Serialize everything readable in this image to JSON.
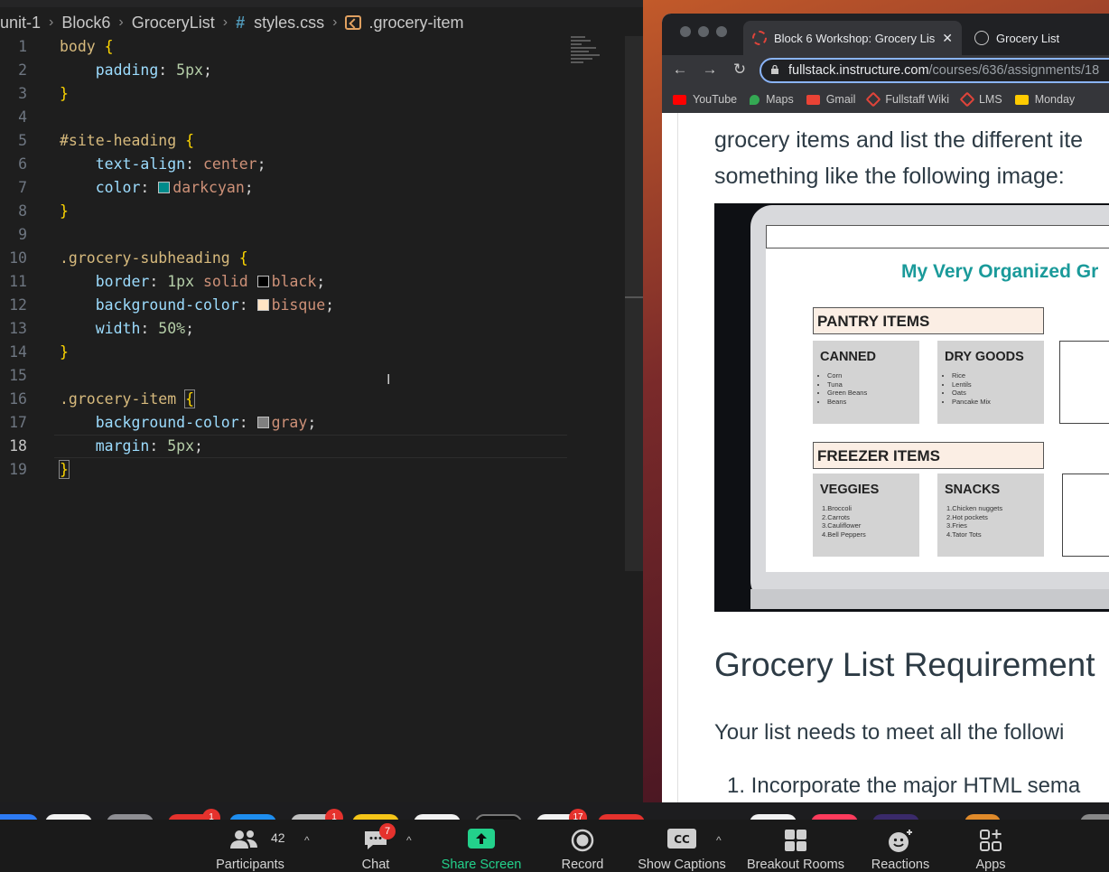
{
  "editor": {
    "breadcrumb": [
      "unit-1",
      "Block6",
      "GroceryList",
      "styles.css",
      ".grocery-item"
    ],
    "lines": [
      {
        "n": "1",
        "code": "body {"
      },
      {
        "n": "2",
        "code": "padding: 5px;"
      },
      {
        "n": "3",
        "code": "}"
      },
      {
        "n": "4",
        "code": ""
      },
      {
        "n": "5",
        "code": "#site-heading {"
      },
      {
        "n": "6",
        "code": "text-align: center;"
      },
      {
        "n": "7",
        "code": "color: darkcyan;"
      },
      {
        "n": "8",
        "code": "}"
      },
      {
        "n": "9",
        "code": ""
      },
      {
        "n": "10",
        "code": ".grocery-subheading {"
      },
      {
        "n": "11",
        "code": "border: 1px solid black;"
      },
      {
        "n": "12",
        "code": "background-color: bisque;"
      },
      {
        "n": "13",
        "code": "width: 50%;"
      },
      {
        "n": "14",
        "code": "}"
      },
      {
        "n": "15",
        "code": ""
      },
      {
        "n": "16",
        "code": ".grocery-item {"
      },
      {
        "n": "17",
        "code": "background-color: gray;"
      },
      {
        "n": "18",
        "code": "margin: 5px;"
      },
      {
        "n": "19",
        "code": "}"
      }
    ],
    "active_line": 18
  },
  "colors": {
    "darkcyan": "#008b8b",
    "black": "#000000",
    "bisque": "#ffe4c4",
    "gray": "#808080",
    "zoom_share_green": "#23d18b"
  },
  "browser": {
    "tabs": [
      {
        "label": "Block 6 Workshop: Grocery Lis",
        "icon": "canvas-icon"
      },
      {
        "label": "Grocery List",
        "icon": "globe-icon"
      }
    ],
    "url_host": "fullstack.instructure.com",
    "url_path": "/courses/636/assignments/18",
    "bookmarks": [
      "YouTube",
      "Maps",
      "Gmail",
      "Fullstaff Wiki",
      "LMS",
      "Monday"
    ],
    "intro_line1": "grocery items and list the different ite",
    "intro_line2": "something like the following image:",
    "figure": {
      "title": "My Very Organized Gr",
      "pantry": "PANTRY ITEMS",
      "canned": {
        "title": "CANNED",
        "items": [
          "Corn",
          "Tuna",
          "Green Beans",
          "Beans"
        ]
      },
      "dry": {
        "title": "DRY GOODS",
        "items": [
          "Rice",
          "Lentils",
          "Oats",
          "Pancake Mix"
        ]
      },
      "freezer": "FREEZER ITEMS",
      "veggies": {
        "title": "VEGGIES",
        "items": [
          "1.Broccoli",
          "2.Carrots",
          "3.Cauliflower",
          "4.Bell Peppers"
        ]
      },
      "snacks": {
        "title": "SNACKS",
        "items": [
          "1.Chicken nuggets",
          "2.Hot pockets",
          "3.Fries",
          "4.Tator Tots"
        ]
      }
    },
    "requirements_heading": "Grocery List Requirement",
    "requirements_intro": "Your list needs to meet all the followi",
    "requirements_item1": "1. Incorporate the major HTML sema"
  },
  "zoom": {
    "participants": {
      "label": "Participants",
      "count": "42"
    },
    "chat": {
      "label": "Chat",
      "badge": "7"
    },
    "share": {
      "label": "Share Screen"
    },
    "record": {
      "label": "Record"
    },
    "captions": {
      "label": "Show Captions"
    },
    "breakout": {
      "label": "Breakout Rooms"
    },
    "reactions": {
      "label": "Reactions"
    },
    "apps": {
      "label": "Apps"
    }
  },
  "dock_badges": [
    "1",
    "1",
    "17"
  ]
}
